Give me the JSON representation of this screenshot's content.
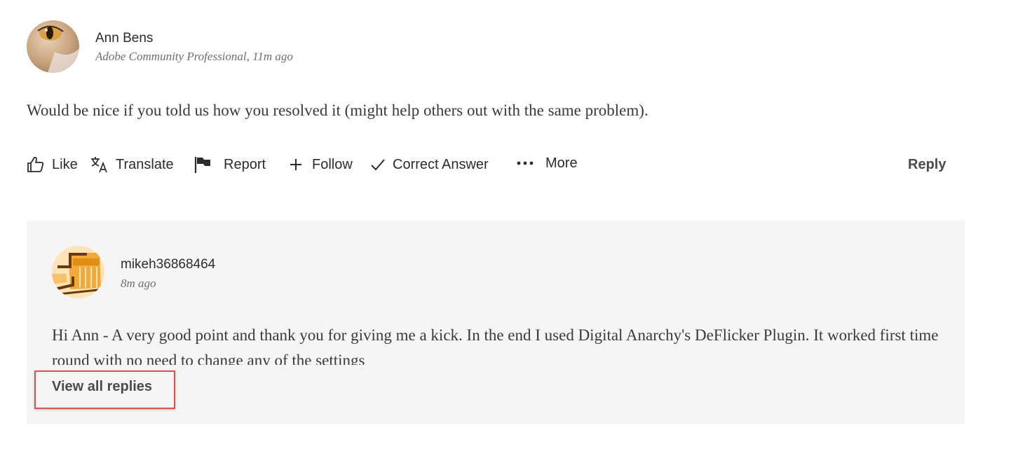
{
  "comment": {
    "author_name": "Ann Bens",
    "author_meta": "Adobe Community Professional, 11m ago",
    "body": "Would be nice if you told us how you resolved it (might help others out with the same problem).",
    "actions": {
      "like": "Like",
      "translate": "Translate",
      "report": "Report",
      "follow": "Follow",
      "correct_answer": "Correct Answer",
      "more": "More",
      "reply": "Reply"
    }
  },
  "reply": {
    "author_name": "mikeh36868464",
    "author_meta": "8m ago",
    "body": "Hi Ann - A very good point and thank you for giving me a kick. In the end I used Digital Anarchy's DeFlicker Plugin. It worked first time round with no need to change any of the settings",
    "view_all_label": "View all replies"
  },
  "icons": {
    "like": "thumbs-up-icon",
    "translate": "translate-icon",
    "report": "flag-icon",
    "follow": "plus-icon",
    "correct_answer": "checkmark-icon",
    "more": "ellipsis-icon"
  },
  "colors": {
    "reply_background": "#f5f5f5",
    "highlight_border": "#d9534f",
    "muted_text": "#6e6e6e"
  }
}
